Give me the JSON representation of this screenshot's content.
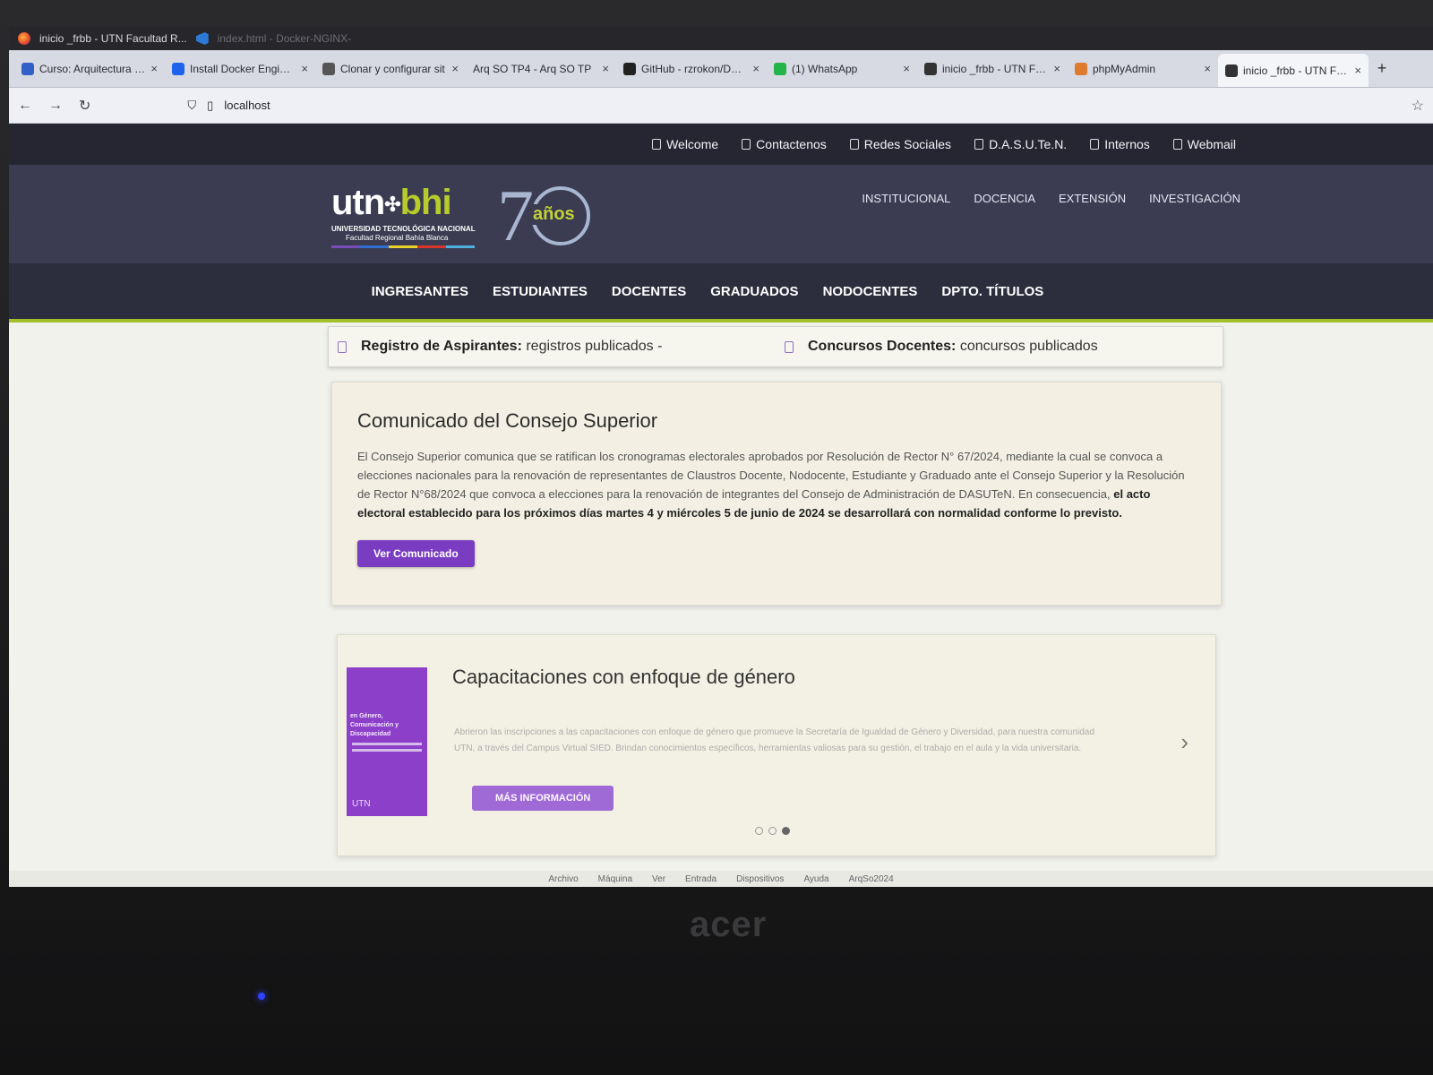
{
  "titlebar": {
    "active_window": "inicio _frbb - UTN Facultad R...",
    "vscode_window": "index.html - Docker-NGINX-"
  },
  "tabs": [
    {
      "label": "Curso: Arquitectura y S",
      "favicon": "moodle-icon",
      "color": "#3360c7"
    },
    {
      "label": "Install Docker Engine o",
      "favicon": "docker-icon",
      "color": "#1d63ed"
    },
    {
      "label": "Clonar y configurar sit",
      "favicon": "github-icon",
      "color": "#555555"
    },
    {
      "label": "Arq SO TP4 - Arq SO TP",
      "favicon": "",
      "color": ""
    },
    {
      "label": "GitHub - rzrokon/Dock",
      "favicon": "github-icon",
      "color": "#222222"
    },
    {
      "label": "(1) WhatsApp",
      "favicon": "whatsapp-icon",
      "color": "#25b34b"
    },
    {
      "label": "inicio _frbb - UTN Facu",
      "favicon": "utn-icon",
      "color": "#333333"
    },
    {
      "label": "phpMyAdmin",
      "favicon": "phpmyadmin-icon",
      "color": "#e07b2d"
    },
    {
      "label": "inicio _frbb - UTN Facu",
      "favicon": "utn-icon",
      "color": "#333333"
    }
  ],
  "address": {
    "url": "localhost"
  },
  "site": {
    "toplinks": [
      "Welcome",
      "Contactenos",
      "Redes Sociales",
      "D.A.S.U.Te.N.",
      "Internos",
      "Webmail"
    ],
    "logo": {
      "utn": "utn",
      "bhi": "bhi",
      "line1": "UNIVERSIDAD TECNOLÓGICA NACIONAL",
      "line2": "Facultad Regional Bahía Blanca",
      "seventy": "7",
      "anos": "años"
    },
    "mainlinks": [
      "INSTITUCIONAL",
      "DOCENCIA",
      "EXTENSIÓN",
      "INVESTIGACIÓN"
    ],
    "menu": [
      "INGRESANTES",
      "ESTUDIANTES",
      "DOCENTES",
      "GRADUADOS",
      "NODOCENTES",
      "DPTO. TÍTULOS"
    ],
    "ticker": [
      {
        "title": "Registro de Aspirantes:",
        "text": "registros publicados -"
      },
      {
        "title": "Concursos Docentes:",
        "text": "concursos publicados"
      }
    ],
    "comunicado": {
      "title": "Comunicado del Consejo Superior",
      "body": "El Consejo Superior comunica que se ratifican los cronogramas electorales aprobados por Resolución de Rector N° 67/2024, mediante la cual se convoca a elecciones nacionales para la renovación de representantes de Claustros Docente, Nodocente, Estudiante y Graduado ante el Consejo Superior y la Resolución de Rector N°68/2024 que convoca a elecciones para la renovación de integrantes del Consejo de Administración de DASUTeN. En consecuencia,",
      "bold": "el acto electoral establecido para los próximos días martes 4 y miércoles 5 de junio de 2024 se desarrollará con normalidad conforme lo previsto.",
      "button": "Ver Comunicado"
    },
    "slide": {
      "title": "Capacitaciones con enfoque de género",
      "text": "Abrieron las inscripciones a las capacitaciones con enfoque de género que promueve la Secretaría de Igualdad de Género y Diversidad, para nuestra comunidad UTN, a través del Campus Virtual SIED. Brindan conocimientos específicos, herramientas valiosas para su gestión, el trabajo en el aula y la vida universitaria.",
      "button": "MÁS INFORMACIÓN",
      "thumb_logo": "UTN",
      "thumb_text": "en Género, Comunicación y Discapacidad",
      "dots": 3,
      "active_dot": 3
    }
  },
  "vm_menu": [
    "Archivo",
    "Máquina",
    "Ver",
    "Entrada",
    "Dispositivos",
    "Ayuda",
    "ArqSo2024"
  ],
  "laptop_brand": "acer"
}
